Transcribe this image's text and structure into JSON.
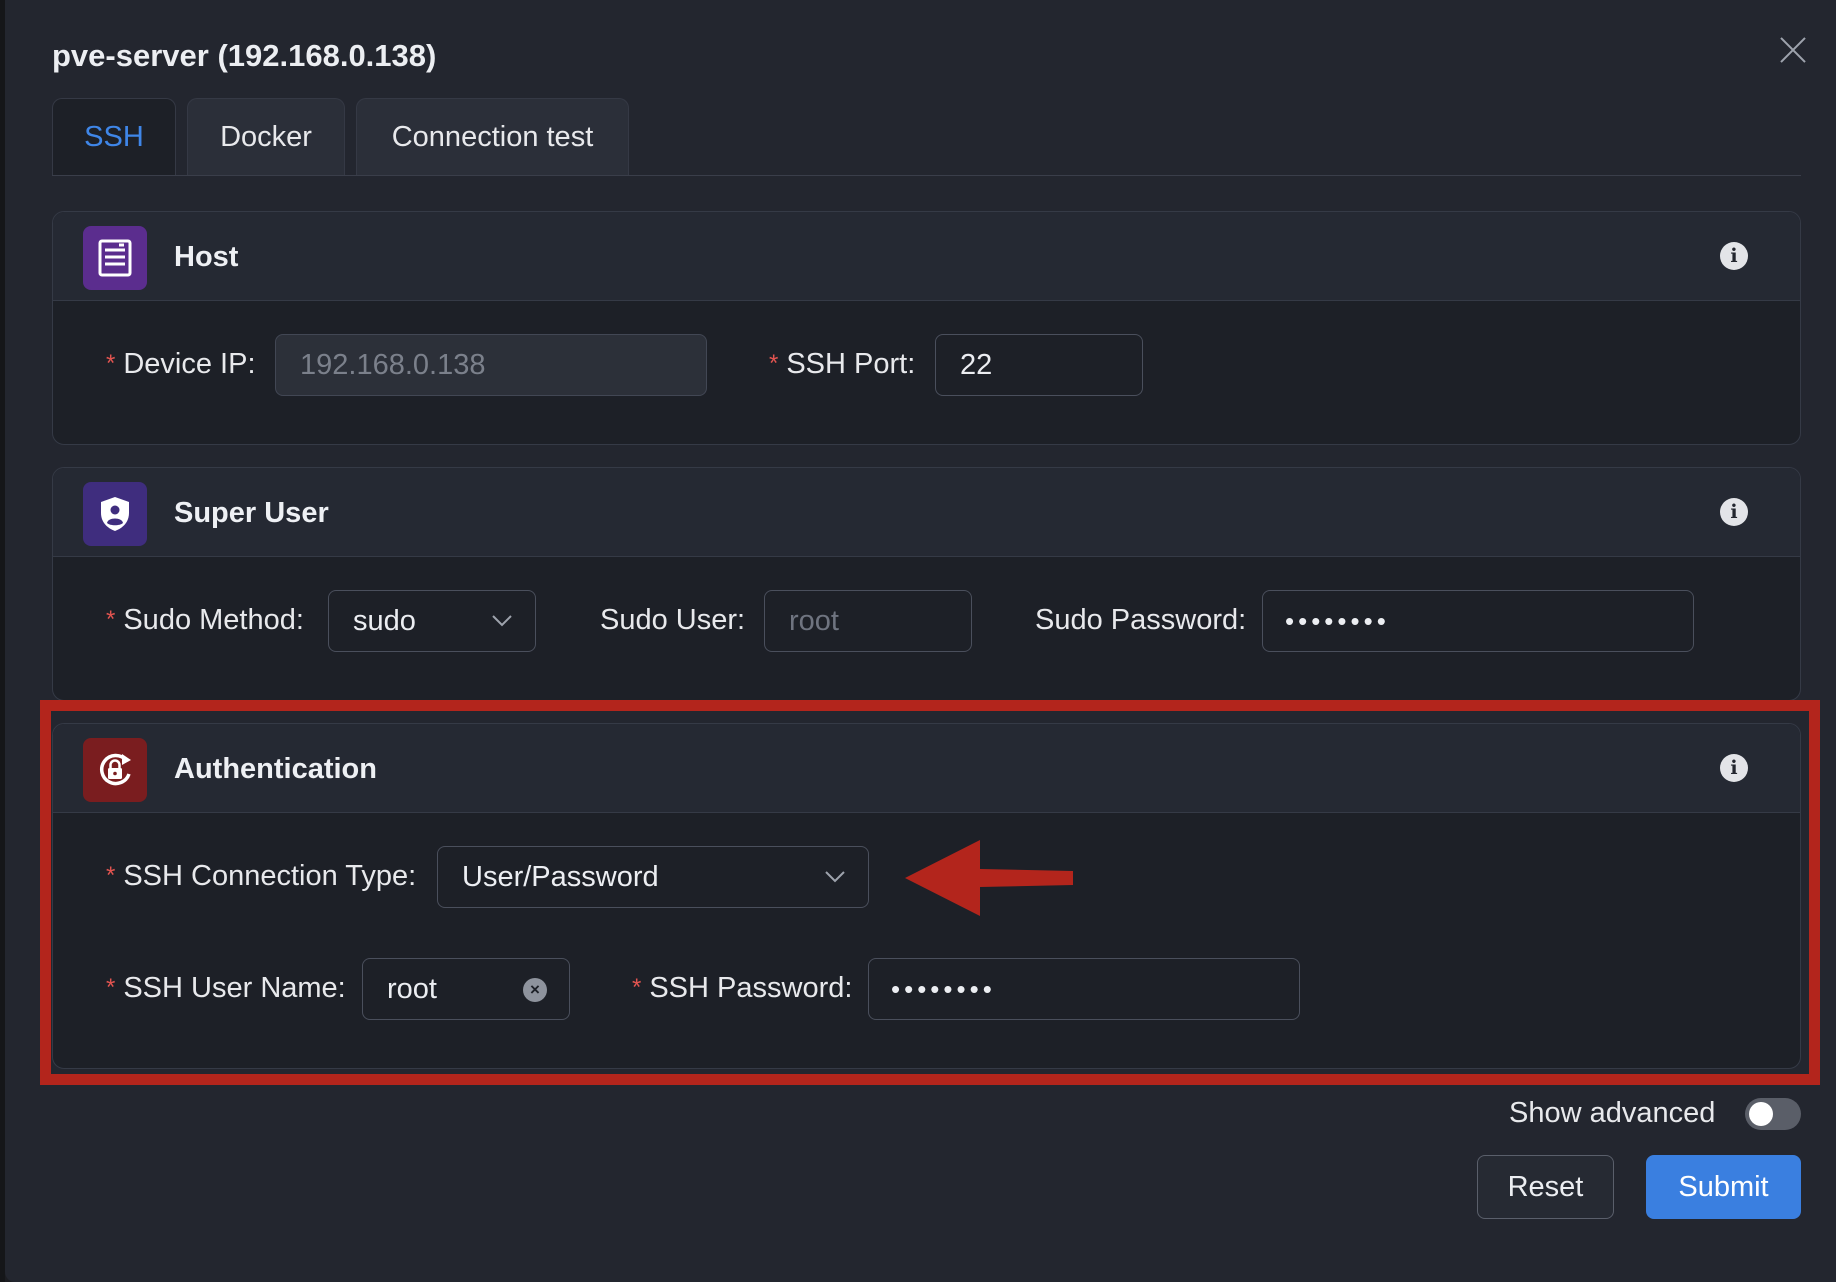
{
  "modal": {
    "title": "pve-server (192.168.0.138)"
  },
  "tabs": [
    {
      "label": "SSH",
      "active": true
    },
    {
      "label": "Docker",
      "active": false
    },
    {
      "label": "Connection test",
      "active": false
    }
  ],
  "sections": {
    "host": {
      "title": "Host",
      "icon": "server-icon",
      "icon_bg": "#5b2d8e",
      "device_ip": {
        "label": "Device IP",
        "value": "192.168.0.138"
      },
      "ssh_port": {
        "label": "SSH Port",
        "value": "22"
      }
    },
    "super_user": {
      "title": "Super User",
      "icon": "shield-user-icon",
      "icon_bg": "#3f2d7e",
      "sudo_method": {
        "label": "Sudo Method",
        "value": "sudo"
      },
      "sudo_user": {
        "label": "Sudo User",
        "placeholder": "root"
      },
      "sudo_password": {
        "label": "Sudo Password",
        "value": "••••••••"
      }
    },
    "authentication": {
      "title": "Authentication",
      "icon": "lock-rotate-icon",
      "icon_bg": "#7a1d1f",
      "connection_type": {
        "label": "SSH Connection Type",
        "value": "User/Password"
      },
      "user_name": {
        "label": "SSH User Name",
        "value": "root"
      },
      "password": {
        "label": "SSH Password",
        "value": "••••••••"
      }
    }
  },
  "footer": {
    "show_advanced_label": "Show advanced",
    "show_advanced_on": false,
    "reset_label": "Reset",
    "submit_label": "Submit"
  },
  "colors": {
    "accent": "#3a7fe0",
    "highlight": "#b3251c",
    "required": "#e25450"
  },
  "annotation": {
    "box": "red-highlight-box",
    "arrow": "red-arrow-pointing-left"
  }
}
